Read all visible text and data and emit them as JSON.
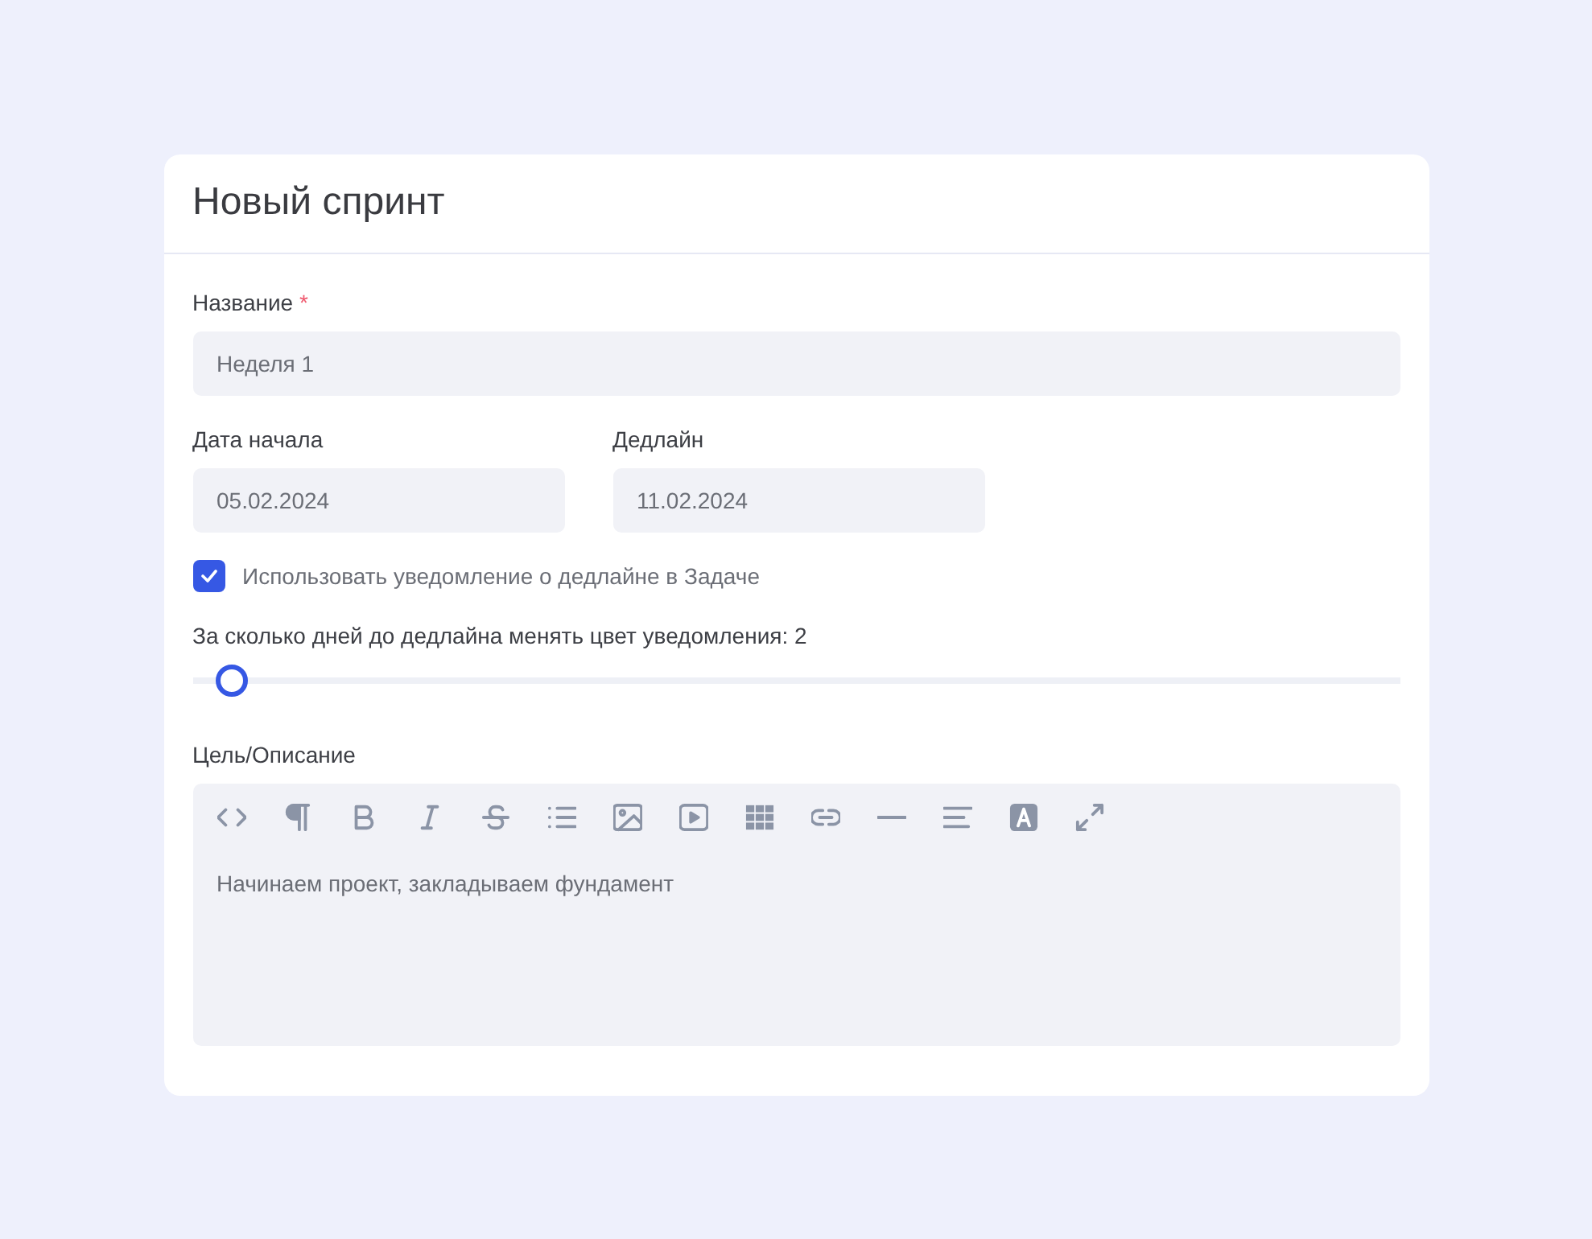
{
  "card": {
    "title": "Новый спринт"
  },
  "name_field": {
    "label": "Название",
    "required_mark": "*",
    "value": "Неделя 1"
  },
  "date_fields": [
    {
      "label": "Дата начала",
      "value": "05.02.2024"
    },
    {
      "label": "Дедлайн",
      "value": "11.02.2024"
    }
  ],
  "deadline_notification": {
    "label": "Использовать уведомление о дедлайне в Задаче",
    "checked": true
  },
  "slider": {
    "label": "За сколько дней до дедлайна менять цвет уведомления: 2",
    "level": 0.02
  },
  "description": {
    "label": "Цель/Описание",
    "toolbar": [
      {
        "kind": "code"
      },
      {
        "kind": "paragraph"
      },
      {
        "kind": "bold"
      },
      {
        "kind": "italic"
      },
      {
        "kind": "strike"
      },
      {
        "kind": "list"
      },
      {
        "kind": "image"
      },
      {
        "kind": "video"
      },
      {
        "kind": "table"
      },
      {
        "kind": "link"
      },
      {
        "kind": "rule"
      },
      {
        "kind": "align"
      },
      {
        "kind": "color"
      },
      {
        "kind": "expand"
      }
    ],
    "text": "Начинаем проект, закладываем фундамент"
  }
}
